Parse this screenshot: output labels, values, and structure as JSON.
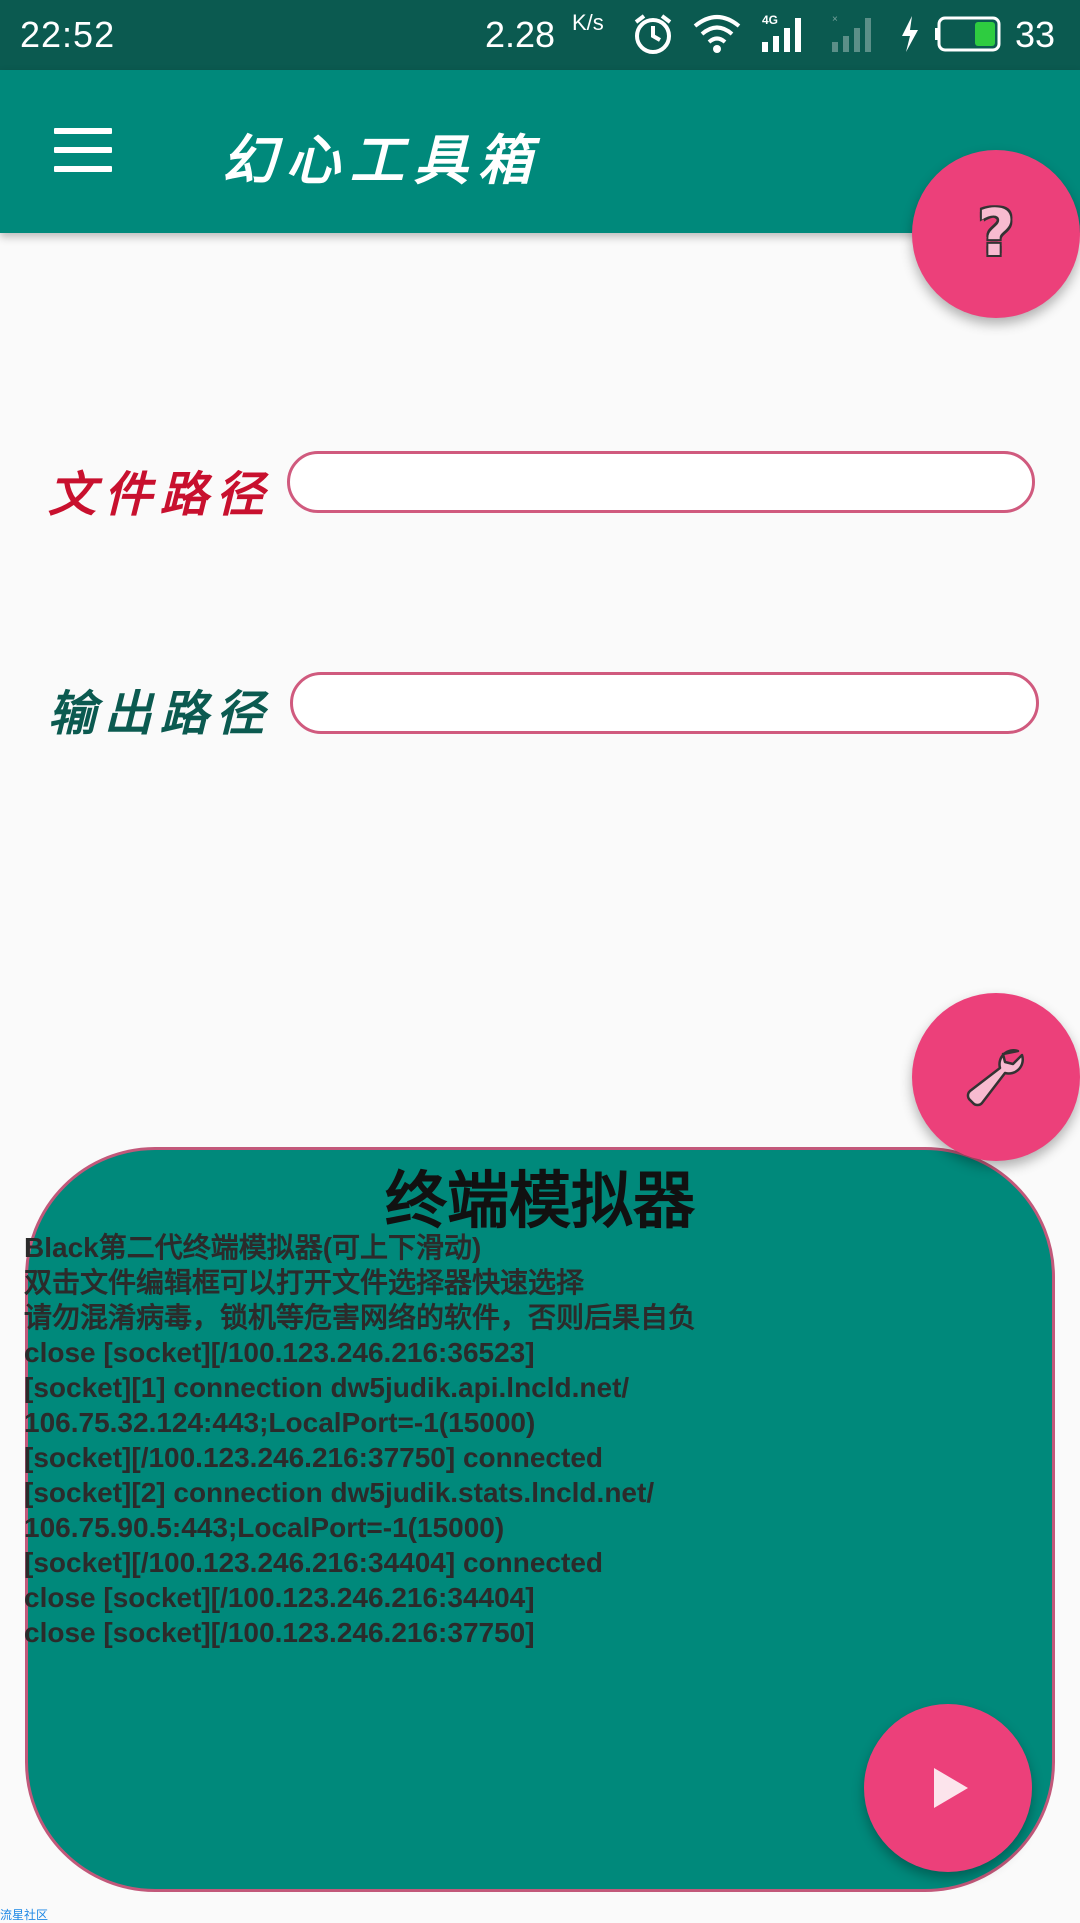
{
  "status_bar": {
    "time": "22:52",
    "net_speed": "2.28",
    "net_speed_unit": "K/s",
    "battery_level": "33",
    "icons": [
      "alarm-icon",
      "wifi-icon",
      "4g-signal-icon",
      "no-signal-icon",
      "charging-icon",
      "battery-icon"
    ]
  },
  "app_bar": {
    "title": "幻心工具箱",
    "menu_icon": "hamburger-menu-icon"
  },
  "help_fab": {
    "label": "?"
  },
  "form": {
    "file_path_label": "文件路径",
    "file_path_value": "",
    "output_path_label": "输出路径",
    "output_path_value": ""
  },
  "tools_fab": {
    "icon": "wrench-icon"
  },
  "terminal": {
    "title": "终端模拟器",
    "lines": [
      "Black第二代终端模拟器(可上下滑动)",
      "双击文件编辑框可以打开文件选择器快速选择",
      "请勿混淆病毒，锁机等危害网络的软件，否则后果自负",
      "close [socket][/100.123.246.216:36523]",
      "[socket][1] connection dw5judik.api.lncld.net/",
      "106.75.32.124:443;LocalPort=-1(15000)",
      "[socket][/100.123.246.216:37750] connected",
      "[socket][2] connection dw5judik.stats.lncld.net/",
      "106.75.90.5:443;LocalPort=-1(15000)",
      "[socket][/100.123.246.216:34404] connected",
      "close [socket][/100.123.246.216:34404]",
      "close [socket][/100.123.246.216:37750]"
    ]
  },
  "run_fab": {
    "icon": "play-icon"
  },
  "watermark": "流星社区",
  "colors": {
    "primary": "#00897b",
    "primary_dark": "#0b5a50",
    "accent": "#ec407a",
    "file_label": "#c8102e",
    "output_label": "#0b5a50"
  }
}
